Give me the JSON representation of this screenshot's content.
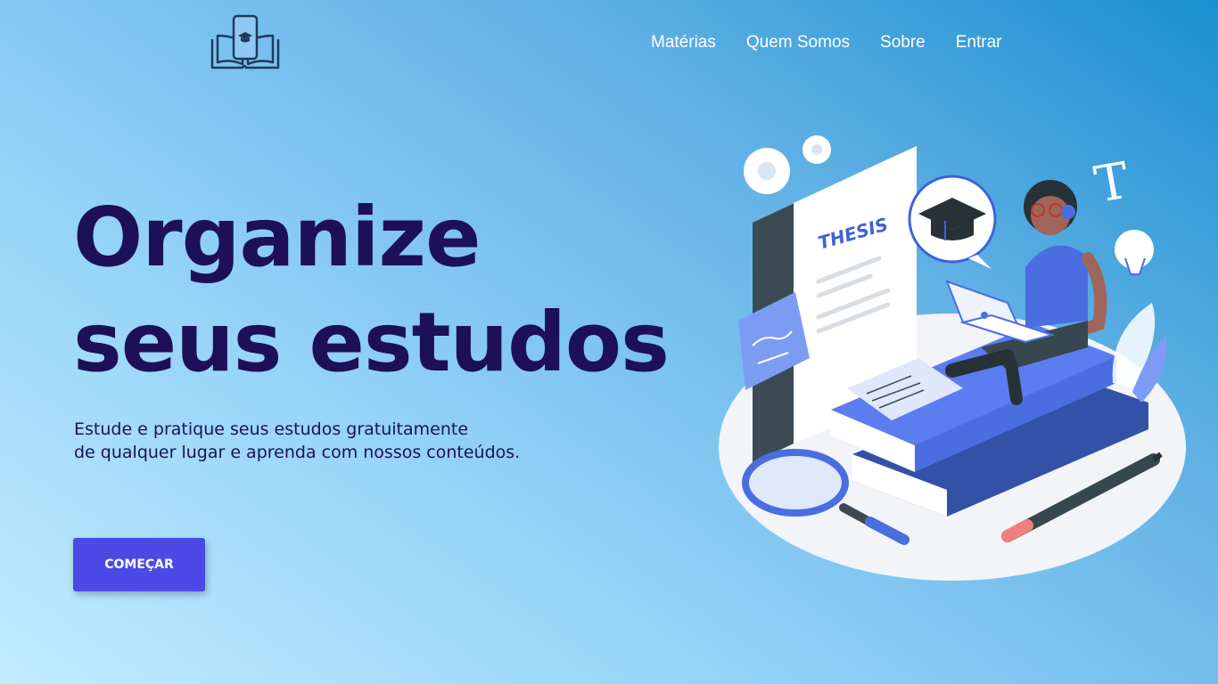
{
  "logo": {
    "icon": "book-phone-graduation-cap-icon"
  },
  "nav": {
    "items": [
      "Matérias",
      "Quem Somos",
      "Sobre",
      "Entrar"
    ]
  },
  "hero": {
    "title": "Organize seus estudos",
    "subtitle_line1": "Estude e pratique seus estudos gratuitamente",
    "subtitle_line2": "de qualquer lugar e aprenda com nossos conteúdos.",
    "cta_label": "COMEÇAR"
  },
  "illustration": {
    "book_label": "THESIS",
    "icons": [
      "gear-icon",
      "graduation-cap-icon",
      "text-t-icon",
      "lightbulb-icon",
      "magnifier-icon",
      "pencil-icon",
      "laptop-icon"
    ]
  },
  "colors": {
    "title": "#1d1056",
    "button": "#4c4ae6",
    "book_blue": "#4a6ee0",
    "nav_text": "#ffffff"
  }
}
